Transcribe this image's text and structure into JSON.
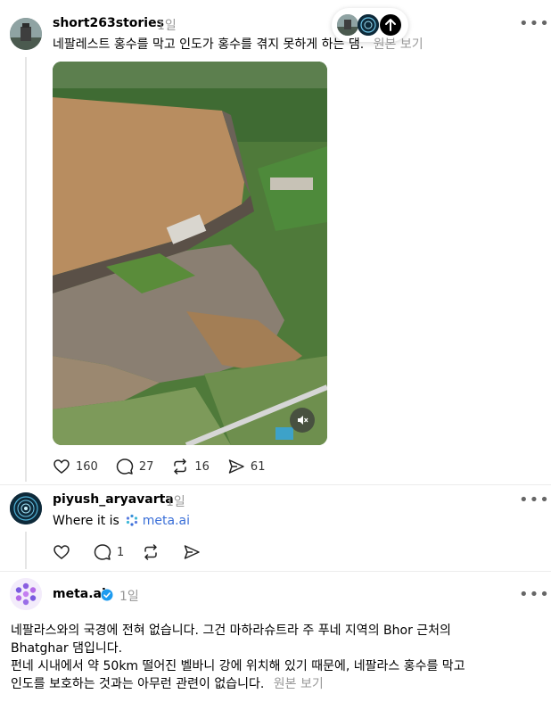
{
  "post1": {
    "username": "short263stories",
    "time": "1일",
    "text": "네팔레스트 홍수를 막고 인도가 홍수를 겪지 못하게 하는 댐.",
    "translate": "원본 보기",
    "likes": "160",
    "comments": "27",
    "reposts": "16",
    "shares": "61"
  },
  "post2": {
    "username": "piyush_aryavarta",
    "time": "1일",
    "text_prefix": "Where it is",
    "mention": "meta.ai",
    "comments": "1"
  },
  "post3": {
    "username": "meta.ai",
    "time": "1일",
    "line1": "네팔라스와의 국경에 전혀 없습니다. 그건 마하라슈트라 주 푸네 지역의 Bhor 근처의",
    "line2": "Bhatghar 댐입니다.",
    "line3": "펀네 시내에서 약 50km 떨어진 벨바니 강에 위치해 있기 때문에, 네팔라스 홍수를 막고",
    "line4": "인도를 보호하는 것과는 아무런 관련이 없습니다.",
    "translate": "원본 보기"
  },
  "colors": {
    "link": "#3a6fd8",
    "verified": "#1d9bf0",
    "muted": "#999999"
  }
}
